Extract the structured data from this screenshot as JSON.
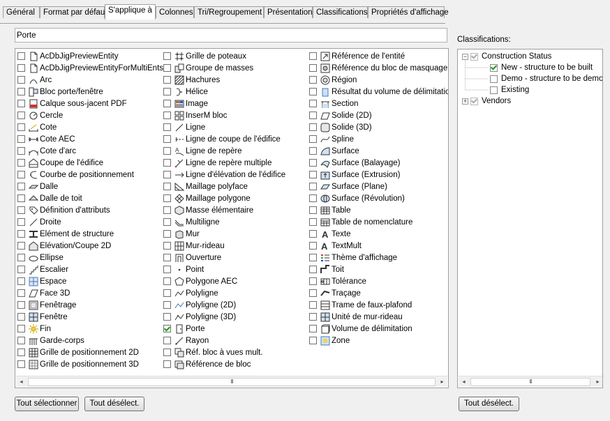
{
  "tabs": [
    {
      "label": "Général",
      "active": false
    },
    {
      "label": "Format par défaut",
      "active": false
    },
    {
      "label": "S'applique à",
      "active": true
    },
    {
      "label": "Colonnes",
      "active": false
    },
    {
      "label": "Tri/Regroupement",
      "active": false
    },
    {
      "label": "Présentation",
      "active": false
    },
    {
      "label": "Classifications",
      "active": false
    },
    {
      "label": "Propriétés d'affichage",
      "active": false
    }
  ],
  "search": {
    "value": "Porte"
  },
  "columns": [
    [
      {
        "label": "AcDbJigPreviewEntity",
        "icon": "document-icon",
        "checked": false
      },
      {
        "label": "AcDbJigPreviewEntityForMultiEnts",
        "icon": "document-icon",
        "checked": false
      },
      {
        "label": "Arc",
        "icon": "arc-icon",
        "checked": false
      },
      {
        "label": "Bloc porte/fenêtre",
        "icon": "door-window-icon",
        "checked": false
      },
      {
        "label": "Calque sous-jacent PDF",
        "icon": "pdf-icon",
        "checked": false
      },
      {
        "label": "Cercle",
        "icon": "circle-icon",
        "checked": false
      },
      {
        "label": "Cote",
        "icon": "dimension-icon",
        "checked": false
      },
      {
        "label": "Cote AEC",
        "icon": "aec-dimension-icon",
        "checked": false
      },
      {
        "label": "Cote d'arc",
        "icon": "arc-dimension-icon",
        "checked": false
      },
      {
        "label": "Coupe de l'édifice",
        "icon": "building-section-icon",
        "checked": false
      },
      {
        "label": "Courbe de positionnement",
        "icon": "layout-curve-icon",
        "checked": false
      },
      {
        "label": "Dalle",
        "icon": "slab-icon",
        "checked": false
      },
      {
        "label": "Dalle de toit",
        "icon": "roof-slab-icon",
        "checked": false
      },
      {
        "label": "Définition d'attributs",
        "icon": "attribute-icon",
        "checked": false
      },
      {
        "label": "Droite",
        "icon": "line-icon",
        "checked": false
      },
      {
        "label": "Elément de structure",
        "icon": "structural-member-icon",
        "checked": false
      },
      {
        "label": "Elévation/Coupe 2D",
        "icon": "elevation-icon",
        "checked": false
      },
      {
        "label": "Ellipse",
        "icon": "ellipse-icon",
        "checked": false
      },
      {
        "label": "Escalier",
        "icon": "stair-icon",
        "checked": false
      },
      {
        "label": "Espace",
        "icon": "space-icon",
        "checked": false
      },
      {
        "label": "Face 3D",
        "icon": "face-3d-icon",
        "checked": false
      },
      {
        "label": "Fenêtrage",
        "icon": "viewport-icon",
        "checked": false
      },
      {
        "label": "Fenêtre",
        "icon": "window-icon",
        "checked": false
      },
      {
        "label": "Fin",
        "icon": "sun-icon",
        "checked": false
      },
      {
        "label": "Garde-corps",
        "icon": "railing-icon",
        "checked": false
      },
      {
        "label": "Grille de positionnement 2D",
        "icon": "grid-icon",
        "checked": false
      },
      {
        "label": "Grille de positionnement 3D",
        "icon": "grid-3d-icon",
        "checked": false
      }
    ],
    [
      {
        "label": "Grille de poteaux",
        "icon": "column-grid-icon",
        "checked": false
      },
      {
        "label": "Groupe de masses",
        "icon": "mass-group-icon",
        "checked": false
      },
      {
        "label": "Hachures",
        "icon": "hatch-icon",
        "checked": false
      },
      {
        "label": "Hélice",
        "icon": "helix-icon",
        "checked": false
      },
      {
        "label": "Image",
        "icon": "image-icon",
        "checked": false
      },
      {
        "label": "InserM bloc",
        "icon": "minsert-icon",
        "checked": false
      },
      {
        "label": "Ligne",
        "icon": "line-icon",
        "checked": false
      },
      {
        "label": "Ligne de coupe de l'édifice",
        "icon": "section-line-icon",
        "checked": false
      },
      {
        "label": "Ligne de repère",
        "icon": "leader-icon",
        "checked": false
      },
      {
        "label": "Ligne de repère multiple",
        "icon": "multileader-icon",
        "checked": false
      },
      {
        "label": "Ligne d'élévation de l'édifice",
        "icon": "elevation-line-icon",
        "checked": false
      },
      {
        "label": "Maillage polyface",
        "icon": "polyface-mesh-icon",
        "checked": false
      },
      {
        "label": "Maillage polygone",
        "icon": "polygon-mesh-icon",
        "checked": false
      },
      {
        "label": "Masse élémentaire",
        "icon": "mass-element-icon",
        "checked": false
      },
      {
        "label": "Multiligne",
        "icon": "mline-icon",
        "checked": false
      },
      {
        "label": "Mur",
        "icon": "wall-icon",
        "checked": false
      },
      {
        "label": "Mur-rideau",
        "icon": "curtain-wall-icon",
        "checked": false
      },
      {
        "label": "Ouverture",
        "icon": "opening-icon",
        "checked": false
      },
      {
        "label": "Point",
        "icon": "point-icon",
        "checked": false
      },
      {
        "label": "Polygone AEC",
        "icon": "aec-polygon-icon",
        "checked": false
      },
      {
        "label": "Polyligne",
        "icon": "polyline-icon",
        "checked": false
      },
      {
        "label": "Polyligne (2D)",
        "icon": "polyline-2d-icon",
        "checked": false
      },
      {
        "label": "Polyligne (3D)",
        "icon": "polyline-3d-icon",
        "checked": false
      },
      {
        "label": "Porte",
        "icon": "door-icon",
        "checked": true
      },
      {
        "label": "Rayon",
        "icon": "ray-icon",
        "checked": false
      },
      {
        "label": "Réf. bloc à vues mult.",
        "icon": "multi-view-block-icon",
        "checked": false
      },
      {
        "label": "Référence de bloc",
        "icon": "block-reference-icon",
        "checked": false
      }
    ],
    [
      {
        "label": "Référence de l'entité",
        "icon": "entity-reference-icon",
        "checked": false
      },
      {
        "label": "Référence du bloc de masquage",
        "icon": "mask-block-icon",
        "checked": false
      },
      {
        "label": "Région",
        "icon": "region-icon",
        "checked": false
      },
      {
        "label": "Résultat du volume de délimitation",
        "icon": "bounding-volume-result-icon",
        "checked": false
      },
      {
        "label": "Section",
        "icon": "section-icon",
        "checked": false
      },
      {
        "label": "Solide (2D)",
        "icon": "solid-2d-icon",
        "checked": false
      },
      {
        "label": "Solide (3D)",
        "icon": "solid-3d-icon",
        "checked": false
      },
      {
        "label": "Spline",
        "icon": "spline-icon",
        "checked": false
      },
      {
        "label": "Surface",
        "icon": "surface-icon",
        "checked": false
      },
      {
        "label": "Surface (Balayage)",
        "icon": "sweep-surface-icon",
        "checked": false
      },
      {
        "label": "Surface (Extrusion)",
        "icon": "extrude-surface-icon",
        "checked": false
      },
      {
        "label": "Surface (Plane)",
        "icon": "planar-surface-icon",
        "checked": false
      },
      {
        "label": "Surface (Révolution)",
        "icon": "revolve-surface-icon",
        "checked": false
      },
      {
        "label": "Table",
        "icon": "table-icon",
        "checked": false
      },
      {
        "label": "Table de nomenclature",
        "icon": "schedule-table-icon",
        "checked": false
      },
      {
        "label": "Texte",
        "icon": "text-icon",
        "checked": false
      },
      {
        "label": "TextMult",
        "icon": "mtext-icon",
        "checked": false
      },
      {
        "label": "Thème d'affichage",
        "icon": "display-theme-icon",
        "checked": false
      },
      {
        "label": "Toit",
        "icon": "roof-icon",
        "checked": false
      },
      {
        "label": "Tolérance",
        "icon": "tolerance-icon",
        "checked": false
      },
      {
        "label": "Traçage",
        "icon": "trace-icon",
        "checked": false
      },
      {
        "label": "Trame de faux-plafond",
        "icon": "ceiling-grid-icon",
        "checked": false
      },
      {
        "label": "Unité de mur-rideau",
        "icon": "curtain-wall-unit-icon",
        "checked": false
      },
      {
        "label": "Volume de délimitation",
        "icon": "bounding-volume-icon",
        "checked": false
      },
      {
        "label": "Zone",
        "icon": "zone-icon",
        "checked": false
      }
    ]
  ],
  "buttons": {
    "select_all": "Tout sélectionner",
    "deselect_all": "Tout désélect.",
    "classifications_deselect_all": "Tout désélect."
  },
  "classifications": {
    "label": "Classifications:",
    "tree": [
      {
        "label": "Construction Status",
        "level": 0,
        "expander": "−",
        "check": "grey"
      },
      {
        "label": "New - structure to be built",
        "level": 1,
        "check": "checked"
      },
      {
        "label": "Demo - structure to be demolis",
        "level": 1,
        "check": "empty"
      },
      {
        "label": "Existing",
        "level": 1,
        "check": "empty"
      },
      {
        "label": "Vendors",
        "level": 0,
        "expander": "+",
        "check": "grey"
      }
    ]
  },
  "scroll_arrows": {
    "left": "◂",
    "right": "▸",
    "thumb_grip": "III"
  },
  "colors": {
    "check": "#1a9a1a",
    "border": "#a0a0a0",
    "panel": "#f0f0f0"
  }
}
